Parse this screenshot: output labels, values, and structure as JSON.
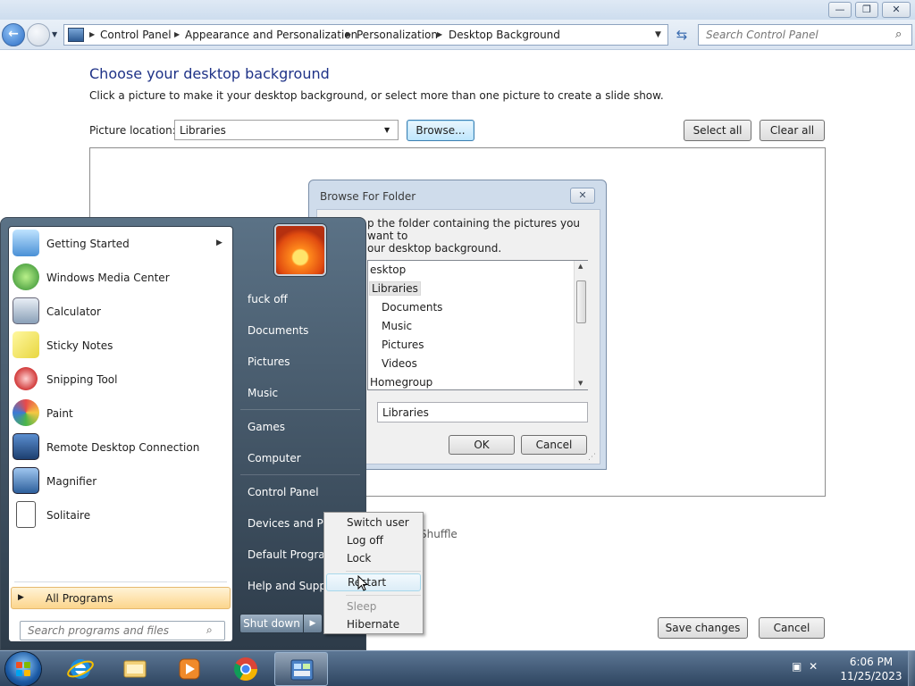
{
  "explorer": {
    "title_buttons": {
      "minimize": "—",
      "maximize": "❐",
      "close": "✕"
    },
    "breadcrumbs": [
      "Control Panel",
      "Appearance and Personalization",
      "Personalization",
      "Desktop Background"
    ],
    "search_placeholder": "Search Control Panel",
    "page_title": "Choose your desktop background",
    "page_subtitle": "Click a picture to make it your desktop background, or select more than one picture to create a slide show.",
    "picture_location_label": "Picture location:",
    "picture_location_value": "Libraries",
    "browse_label": "Browse...",
    "select_all_label": "Select all",
    "clear_all_label": "Clear all",
    "shuffle_label": "Shuffle",
    "save_changes_label": "Save changes",
    "cancel_label": "Cancel"
  },
  "browse_dialog": {
    "title": "Browse For Folder",
    "instruction_line1": "p the folder containing the pictures you want to",
    "instruction_line2": "our desktop background.",
    "tree": [
      "esktop",
      "Libraries",
      "Documents",
      "Music",
      "Pictures",
      "Videos",
      "Homegroup"
    ],
    "selected_item": "Libraries",
    "folder_value": "Libraries",
    "ok_label": "OK",
    "cancel_label": "Cancel"
  },
  "start_menu": {
    "programs": [
      {
        "label": "Getting Started",
        "icon": "getting-started-icon",
        "has_submenu": true
      },
      {
        "label": "Windows Media Center",
        "icon": "media-center-icon"
      },
      {
        "label": "Calculator",
        "icon": "calculator-icon"
      },
      {
        "label": "Sticky Notes",
        "icon": "sticky-notes-icon"
      },
      {
        "label": "Snipping Tool",
        "icon": "snipping-tool-icon"
      },
      {
        "label": "Paint",
        "icon": "paint-icon"
      },
      {
        "label": "Remote Desktop Connection",
        "icon": "remote-desktop-icon"
      },
      {
        "label": "Magnifier",
        "icon": "magnifier-icon"
      },
      {
        "label": "Solitaire",
        "icon": "solitaire-icon"
      }
    ],
    "all_programs_label": "All Programs",
    "search_placeholder": "Search programs and files",
    "right_items": [
      "fuck off",
      "Documents",
      "Pictures",
      "Music",
      "Games",
      "Computer",
      "Control Panel",
      "Devices and Prin",
      "Default Program",
      "Help and Suppo"
    ],
    "shutdown_label": "Shut down"
  },
  "power_menu": {
    "items": [
      {
        "label": "Switch user",
        "enabled": true
      },
      {
        "label": "Log off",
        "enabled": true
      },
      {
        "label": "Lock",
        "enabled": true
      },
      {
        "label": "Restart",
        "enabled": true,
        "hovered": true
      },
      {
        "label": "Sleep",
        "enabled": false
      },
      {
        "label": "Hibernate",
        "enabled": true
      }
    ]
  },
  "taskbar": {
    "apps": [
      {
        "icon": "internet-explorer-icon",
        "active": false
      },
      {
        "icon": "file-explorer-icon",
        "active": false
      },
      {
        "icon": "media-player-icon",
        "active": false
      },
      {
        "icon": "chrome-icon",
        "active": false
      },
      {
        "icon": "control-panel-icon",
        "active": true
      }
    ],
    "time": "6:06 PM",
    "date": "11/25/2023"
  },
  "colors": {
    "title_text": "#1e3287",
    "accent": "#3c7fb1",
    "hover_item": "#dcedf7"
  }
}
